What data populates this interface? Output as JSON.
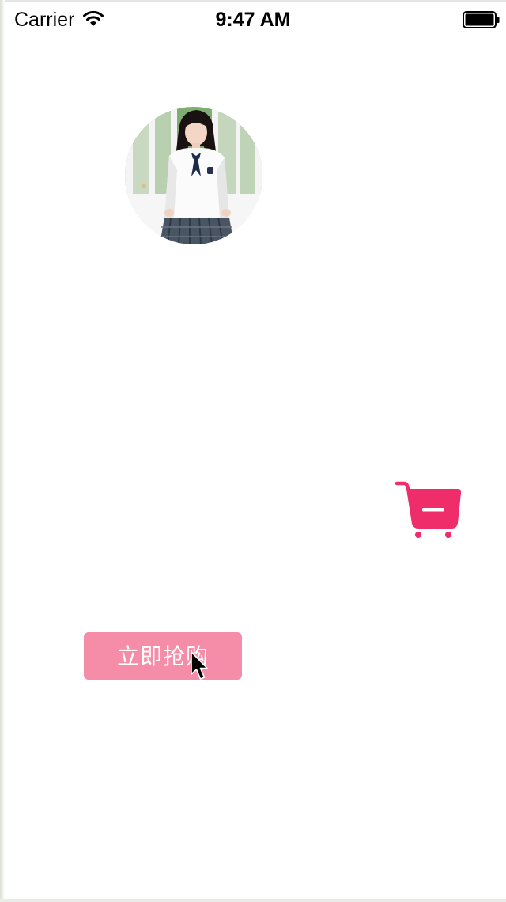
{
  "status_bar": {
    "carrier": "Carrier",
    "time": "9:47 AM"
  },
  "avatar": {
    "icon": "profile-photo"
  },
  "cart": {
    "icon": "shopping-cart-remove-icon",
    "color": "#ee2d6a"
  },
  "buy_button": {
    "label": "立即抢购",
    "color": "#f58ca8"
  }
}
